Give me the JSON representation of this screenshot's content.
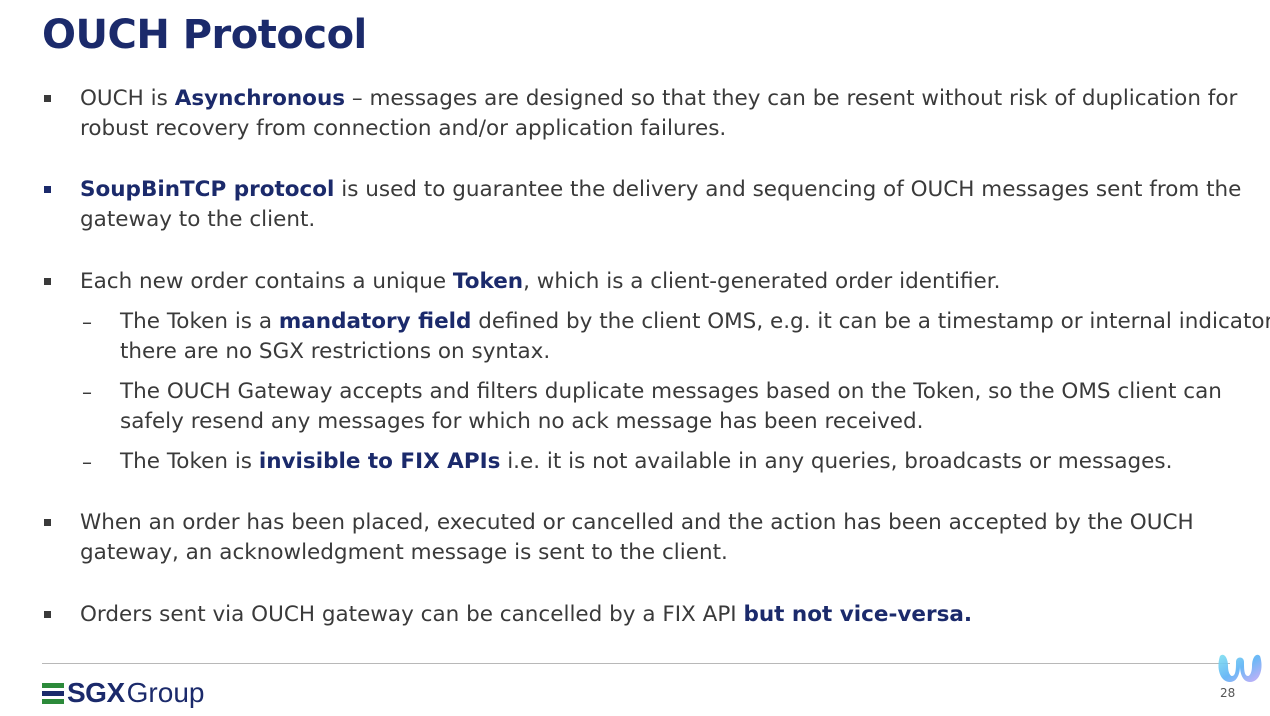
{
  "slide": {
    "title": "OUCH Protocol",
    "page_number": "28"
  },
  "bullets": {
    "b1": {
      "l1_pre": "OUCH is ",
      "l1_em": "Asynchronous",
      "l1_post": " – messages are designed so that they can be resent without risk of duplication for",
      "l2": "robust recovery from connection and/or application failures."
    },
    "b2": {
      "l1_em": "SoupBinTCP protocol",
      "l1_post": " is used to guarantee the delivery and sequencing of OUCH messages sent from the",
      "l2": "gateway to the client."
    },
    "b3": {
      "l1_pre": "Each new order contains a unique ",
      "l1_em": "Token",
      "l1_post": ", which is a client-generated order identifier.",
      "sub1_l1_pre": "The Token is a ",
      "sub1_l1_em": "mandatory field",
      "sub1_l1_post": " defined by the client OMS, e.g. it can be a timestamp or internal indicator,",
      "sub1_l2": "there are no SGX restrictions on syntax.",
      "sub2_l1": "The OUCH Gateway accepts and filters duplicate messages based on the Token, so the OMS client can",
      "sub2_l2": "safely resend any messages for which no ack message has been received.",
      "sub3_pre": "The Token is ",
      "sub3_em": "invisible to FIX APIs",
      "sub3_post": " i.e. it is not available in any queries, broadcasts or messages."
    },
    "b4": {
      "l1": "When an order has been placed, executed or cancelled and the action has been accepted by the OUCH",
      "l2": "gateway, an acknowledgment message is sent to the client."
    },
    "b5": {
      "l1_pre": "Orders sent via OUCH gateway can be cancelled by a FIX API ",
      "l1_em": "but not vice-versa."
    },
    "dash_glyph": "–"
  },
  "footer": {
    "logo_sgx": "SGX",
    "logo_group": "Group"
  },
  "colors": {
    "title": "#1b2a6b",
    "emphasis": "#1b2a6b",
    "body_text": "#3a3a3a",
    "logo_green": "#2c8a3a"
  }
}
